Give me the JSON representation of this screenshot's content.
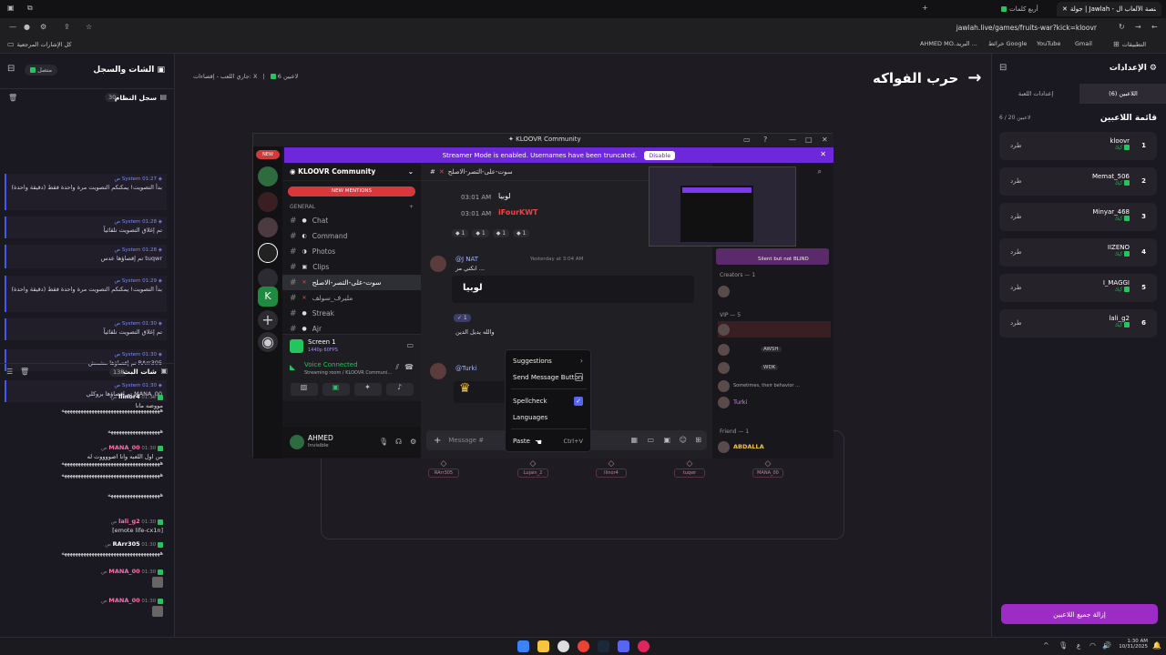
{
  "browser": {
    "tabs": [
      {
        "label": "جولة | Jawlah - منصة الألعاب ال...",
        "active": true
      },
      {
        "label": "أربع كلمات",
        "active": false
      }
    ],
    "url": "jawlah.live/games/fruits-war?kick=kloovr",
    "bookmarks": [
      "Gmail",
      "YouTube",
      "خرائط Google",
      "البريد ...",
      "AHMED MO...",
      "التطبيقات",
      "كل الإشارات المرجعية"
    ]
  },
  "left_panel": {
    "title": "الشات والسجل",
    "status": "متصل",
    "system_log": {
      "title": "سجل النظام",
      "count": "30",
      "entries": [
        {
          "sender": "System",
          "time": "01:27 ص",
          "text": "بدأ التصويت! يمكنكم التصويت مرة واحدة فقط (دقيقة واحدة)"
        },
        {
          "sender": "System",
          "time": "01:28 ص",
          "text": "تم إغلاق التصويت تلقائياً"
        },
        {
          "sender": "System",
          "time": "01:28 ص",
          "text": "tuqwr تم إقصاؤها عدس"
        },
        {
          "sender": "System",
          "time": "01:29 ص",
          "text": "بدأ التصويت! يمكنكم التصويت مرة واحدة فقط (دقيقة واحدة)"
        },
        {
          "sender": "System",
          "time": "01:30 ص",
          "text": "تم إغلاق التصويت تلقائياً"
        },
        {
          "sender": "System",
          "time": "01:30 ص",
          "text": "RArr305 تم إقصاؤها مشمش"
        },
        {
          "sender": "System",
          "time": "01:30 ص",
          "text": "MANA_00 تم إقصاؤها بروكلي"
        }
      ]
    },
    "live_chat": {
      "title": "شات البث",
      "count": "138",
      "messages": [
        {
          "name": "llinor4",
          "time": "01:30 ص",
          "text": "مووضه مانا"
        },
        {
          "name": "",
          "time": "",
          "text": "ههههههههههههههههههههههههههههههههههههه"
        },
        {
          "name": "",
          "time": "",
          "text": "هههههههههههههههههههه"
        },
        {
          "name": "MANA_00",
          "time": "01:30 ص",
          "text": "من اول اللعبه وانا اصووووت له"
        },
        {
          "name": "",
          "time": "",
          "text": "ههههههههههههههههههههههههههههههههههههه"
        },
        {
          "name": "",
          "time": "",
          "text": "ههههههههههههههههههههههههههههههههههههه"
        },
        {
          "name": "",
          "time": "",
          "text": "هههههههههههههههههههه"
        },
        {
          "name": "lali_g2",
          "time": "01:30 ص",
          "text": "[emote life-cx1n]"
        },
        {
          "name": "RArr305",
          "time": "01:30 ص",
          "text": "ههههههههههههههههههههههههههههههههههههه"
        },
        {
          "name": "MANA_00",
          "time": "01:30 ص",
          "text": ""
        },
        {
          "name": "MANA_00",
          "time": "01:30 ص",
          "text": ""
        }
      ]
    }
  },
  "center": {
    "title": "حرب الفواكه",
    "players_count": "6 لاعبين",
    "status": "جاري اللعب - إقصاءات: X",
    "eliminated_slots": [
      "RArr305",
      "Lujain_2",
      "llinor4",
      "tuqwr",
      "MANA_00"
    ]
  },
  "discord": {
    "window_title": "KLOOVR Community",
    "streamer_notice": "Streamer Mode is enabled. Usernames have been truncated.",
    "disable_label": "Disable",
    "server_name": "KLOOVR Community",
    "new_mentions": "NEW MENTIONS",
    "category": "GENERAL",
    "channels": [
      "Chat",
      "Command",
      "Photos",
      "Clips",
      "سوت-على-التصر-الاصلح",
      "مليرف_سولف",
      "Streak",
      "Ajr"
    ],
    "current_channel": "سوت-على-التصر-الاصلح",
    "screen_share": "Screen 1",
    "screen_share_sub": "1440p 60FPS",
    "voice_status": "Voice Connected",
    "voice_sub": "Streaming room / KLOOVR Communi...",
    "user_name": "AHMED",
    "user_status": "Invisible",
    "messages": [
      {
        "time": "03:01 AM",
        "text": "لوبيا"
      },
      {
        "time": "03:01 AM",
        "text": "iFourKWT"
      },
      {
        "author": "@J NAT",
        "time": "Yesterday at 3:04 AM",
        "text": "انكتي مر ..."
      },
      {
        "text": "لوبيا"
      },
      {
        "text": "والله يديل الدين"
      },
      {
        "author": "@Turki",
        "text": ""
      }
    ],
    "message_placeholder": "Message #",
    "members": {
      "creators_label": "Creators — 1",
      "vip_label": "VIP — 5",
      "friend_label": "Friend — 1",
      "entries": [
        "Silent but not BLIND",
        "AWSH",
        "WDK",
        "Sometimes, their behavior ...",
        "Turki",
        "ABDALLA"
      ]
    },
    "context_menu": {
      "items": [
        "Suggestions",
        "Send Message Button",
        "Spellcheck",
        "Languages",
        "Paste"
      ],
      "paste_shortcut": "Ctrl+V"
    }
  },
  "right_panel": {
    "title": "الإعدادات",
    "tab_players": "اللاعبين (6)",
    "tab_settings": "إعدادات اللعبة",
    "list_title": "قائمة اللاعبين",
    "list_count": "6 / 20 لاعبين",
    "kick_label": "طرد",
    "players": [
      {
        "num": "1",
        "name": "kloovr",
        "sub": "كيك"
      },
      {
        "num": "2",
        "name": "Memat_506",
        "sub": "كيك"
      },
      {
        "num": "3",
        "name": "Minyar_468",
        "sub": "كيك"
      },
      {
        "num": "4",
        "name": "IIZENO",
        "sub": "كيك"
      },
      {
        "num": "5",
        "name": "I_MAGGI",
        "sub": "كيك"
      },
      {
        "num": "6",
        "name": "lali_g2",
        "sub": "كيك"
      }
    ],
    "remove_all": "إزالة جميع اللاعبين"
  },
  "taskbar": {
    "time": "1:30 AM",
    "date": "10/31/2025",
    "lang": "ع"
  }
}
